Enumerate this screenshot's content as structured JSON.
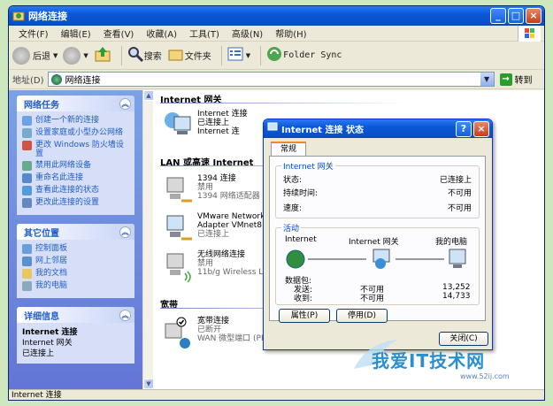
{
  "window": {
    "title": "网络连接"
  },
  "menubar": [
    "文件(F)",
    "编辑(E)",
    "查看(V)",
    "收藏(A)",
    "工具(T)",
    "高级(N)",
    "帮助(H)"
  ],
  "toolbar": {
    "back": "后退",
    "search": "搜索",
    "folders": "文件夹",
    "folder_sync": "Folder Sync"
  },
  "address": {
    "label": "地址(D)",
    "value": "网络连接",
    "go": "转到"
  },
  "left": {
    "network_tasks": {
      "title": "网络任务",
      "items": [
        "创建一个新的连接",
        "设置家庭或小型办公网络",
        "更改 Windows 防火墙设置",
        "禁用此网络设备",
        "重命名此连接",
        "查看此连接的状态",
        "更改此连接的设置"
      ]
    },
    "other_places": {
      "title": "其它位置",
      "items": [
        "控制面板",
        "网上邻居",
        "我的文档",
        "我的电脑"
      ]
    },
    "details": {
      "title": "详细信息",
      "name": "Internet 连接",
      "type": "Internet 网关",
      "status": "已连接上"
    }
  },
  "main": {
    "group_internet": "Internet 网关",
    "internet_conn": {
      "line1": "Internet 连接",
      "line2": "已连接上",
      "line3": "Internet 连"
    },
    "group_lan": "LAN 或高速 Internet",
    "lan": [
      {
        "name": "1394 连接",
        "status": "禁用",
        "device": "1394 网络适配器"
      },
      {
        "name": "VMware Network",
        "status": "Adapter VMnet8",
        "device": "已连接上"
      },
      {
        "name": "无线网络连接",
        "status": "禁用",
        "device": "11b/g Wireless L"
      }
    ],
    "group_broadband": "宽带",
    "broadband": {
      "name": "宽带连接",
      "status": "已断开",
      "device": "WAN 微型端口 (PP"
    }
  },
  "statusbar": "Internet 连接",
  "dialog": {
    "title": "Internet 连接 状态",
    "tab": "常规",
    "gw_legend": "Internet 网关",
    "status_label": "状态:",
    "status_value": "已连接上",
    "duration_label": "持续时间:",
    "duration_value": "不可用",
    "speed_label": "速度:",
    "speed_value": "不可用",
    "activity_legend": "活动",
    "act_internet": "Internet",
    "act_gateway": "Internet 网关",
    "act_computer": "我的电脑",
    "packets_label": "数据包:",
    "sent_label": "发送:",
    "sent_mid": "不可用",
    "sent_value": "13,252",
    "recv_label": "收到:",
    "recv_mid": "不可用",
    "recv_value": "14,733",
    "btn_props": "属性(P)",
    "btn_disable": "停用(D)",
    "btn_close": "关闭(C)"
  },
  "watermark": {
    "text": "我爱IT技术网",
    "url": "www.52ij.com"
  }
}
